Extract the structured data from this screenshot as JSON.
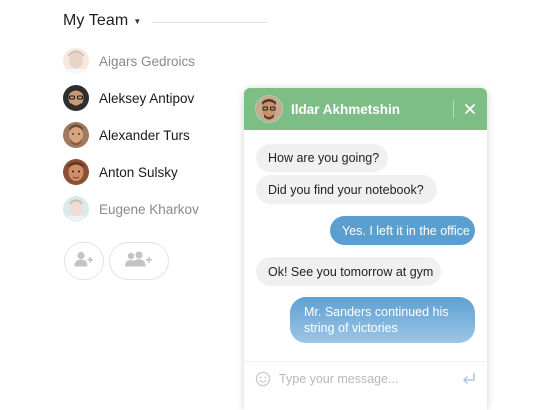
{
  "team": {
    "title": "My Team",
    "caret_icon": "caret-down-icon",
    "members": [
      {
        "name": "Aigars Gedroics",
        "status": "away"
      },
      {
        "name": "Aleksey Antipov",
        "status": "online"
      },
      {
        "name": "Alexander Turs",
        "status": "online"
      },
      {
        "name": "Anton Sulsky",
        "status": "online"
      },
      {
        "name": "Eugene Kharkov",
        "status": "away"
      }
    ],
    "actions": [
      {
        "icon": "add-user-icon"
      },
      {
        "icon": "add-group-icon"
      }
    ]
  },
  "chat": {
    "contact_name": "Ildar Akhmetshin",
    "header_color": "#7dbd86",
    "outgoing_color": "#5b9fd0",
    "incoming_color": "#f0f0f0",
    "messages": [
      {
        "direction": "in",
        "text": "How are you going?"
      },
      {
        "direction": "in",
        "text": "Did you find your notebook?"
      },
      {
        "direction": "out",
        "text": "Yes. I left it in the office"
      },
      {
        "direction": "in",
        "text": "Ok! See you tomorrow at gym"
      },
      {
        "direction": "out",
        "text": "Mr. Sanders continued his string of victories"
      }
    ],
    "composer": {
      "placeholder": "Type your message...",
      "value": ""
    }
  }
}
